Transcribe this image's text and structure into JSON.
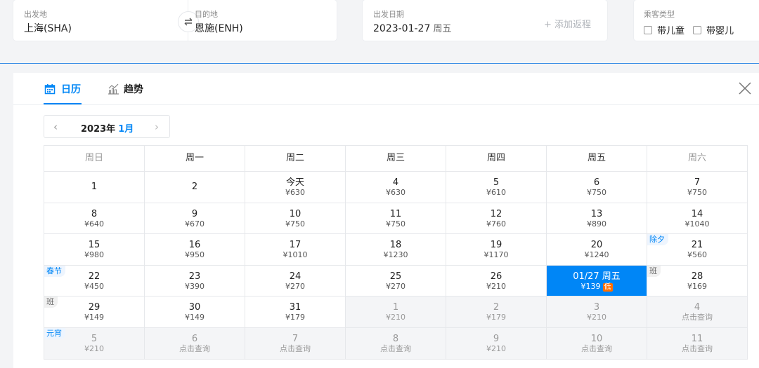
{
  "search": {
    "from_label": "出发地",
    "from_value": "上海(SHA)",
    "to_label": "目的地",
    "to_value": "恩施(ENH)",
    "date_label": "出发日期",
    "date_value": "2023-01-27",
    "date_weekday": "周五",
    "add_return": "+ 添加返程",
    "passenger_label": "乘客类型",
    "child_label": "带儿童",
    "infant_label": "带婴儿"
  },
  "calendar": {
    "tab_calendar": "日历",
    "tab_trend": "趋势",
    "year_label": "2023年",
    "month_label": "1月",
    "weekdays": [
      "周日",
      "周一",
      "周二",
      "周三",
      "周四",
      "周五",
      "周六"
    ],
    "low_badge": "低",
    "accent_color": "#0086f6",
    "rows": [
      [
        {
          "d": "1",
          "p": "",
          "type": "cur"
        },
        {
          "d": "2",
          "p": "",
          "type": "cur"
        },
        {
          "d": "今天",
          "p": "¥630",
          "type": "cur"
        },
        {
          "d": "4",
          "p": "¥630",
          "type": "cur"
        },
        {
          "d": "5",
          "p": "¥610",
          "type": "cur"
        },
        {
          "d": "6",
          "p": "¥750",
          "type": "cur"
        },
        {
          "d": "7",
          "p": "¥750",
          "type": "cur"
        }
      ],
      [
        {
          "d": "8",
          "p": "¥640",
          "type": "cur"
        },
        {
          "d": "9",
          "p": "¥670",
          "type": "cur"
        },
        {
          "d": "10",
          "p": "¥750",
          "type": "cur"
        },
        {
          "d": "11",
          "p": "¥750",
          "type": "cur"
        },
        {
          "d": "12",
          "p": "¥760",
          "type": "cur"
        },
        {
          "d": "13",
          "p": "¥890",
          "type": "cur"
        },
        {
          "d": "14",
          "p": "¥1040",
          "type": "cur"
        }
      ],
      [
        {
          "d": "15",
          "p": "¥980",
          "type": "cur"
        },
        {
          "d": "16",
          "p": "¥950",
          "type": "cur"
        },
        {
          "d": "17",
          "p": "¥1010",
          "type": "cur"
        },
        {
          "d": "18",
          "p": "¥1230",
          "type": "cur"
        },
        {
          "d": "19",
          "p": "¥1170",
          "type": "cur"
        },
        {
          "d": "20",
          "p": "¥1240",
          "type": "cur"
        },
        {
          "d": "21",
          "p": "¥560",
          "type": "cur",
          "tag": "除夕",
          "tagType": "hol"
        }
      ],
      [
        {
          "d": "22",
          "p": "¥450",
          "type": "cur",
          "tag": "春节",
          "tagType": "hol"
        },
        {
          "d": "23",
          "p": "¥390",
          "type": "cur"
        },
        {
          "d": "24",
          "p": "¥270",
          "type": "cur"
        },
        {
          "d": "25",
          "p": "¥270",
          "type": "cur"
        },
        {
          "d": "26",
          "p": "¥210",
          "type": "cur"
        },
        {
          "d": "01/27 周五",
          "p": "¥139",
          "type": "sel",
          "low": true
        },
        {
          "d": "28",
          "p": "¥169",
          "type": "cur",
          "tag": "班",
          "tagType": "work"
        }
      ],
      [
        {
          "d": "29",
          "p": "¥149",
          "type": "cur",
          "tag": "班",
          "tagType": "work"
        },
        {
          "d": "30",
          "p": "¥149",
          "type": "cur"
        },
        {
          "d": "31",
          "p": "¥179",
          "type": "cur"
        },
        {
          "d": "1",
          "p": "¥210",
          "type": "next"
        },
        {
          "d": "2",
          "p": "¥179",
          "type": "next"
        },
        {
          "d": "3",
          "p": "¥210",
          "type": "next"
        },
        {
          "d": "4",
          "p": "点击查询",
          "type": "next"
        }
      ],
      [
        {
          "d": "5",
          "p": "¥210",
          "type": "next",
          "tag": "元宵",
          "tagType": "hol"
        },
        {
          "d": "6",
          "p": "点击查询",
          "type": "next"
        },
        {
          "d": "7",
          "p": "点击查询",
          "type": "next"
        },
        {
          "d": "8",
          "p": "点击查询",
          "type": "next"
        },
        {
          "d": "9",
          "p": "¥210",
          "type": "next"
        },
        {
          "d": "10",
          "p": "点击查询",
          "type": "next"
        },
        {
          "d": "11",
          "p": "点击查询",
          "type": "next"
        }
      ]
    ]
  }
}
